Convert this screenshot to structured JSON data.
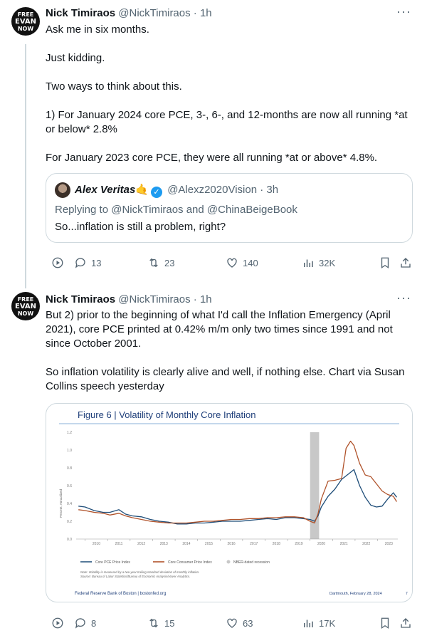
{
  "tweet1": {
    "avatar": {
      "line1": "FREE",
      "line2": "EVAN",
      "line3": "NOW"
    },
    "name": "Nick Timiraos",
    "handle": "@NickTimiraos",
    "time": "· 1h",
    "paragraphs": [
      "Ask me in six months.",
      "Just kidding.",
      "Two ways to think about this.",
      "1) For January 2024 core PCE, 3-, 6-, and 12-months are now all running *at or below* 2.8%",
      "For January 2023 core PCE, they were all running *at or above* 4.8%."
    ],
    "quote": {
      "name": "Alex Veritas",
      "emoji": "🤙",
      "handle": "@Alexz2020Vision",
      "time": "· 3h",
      "replying": "Replying to @NickTimiraos and @ChinaBeigeBook",
      "text": "So...inflation is still a problem, right?"
    },
    "actions": {
      "reply": "13",
      "retweet": "23",
      "like": "140",
      "views": "32K"
    }
  },
  "tweet2": {
    "name": "Nick Timiraos",
    "handle": "@NickTimiraos",
    "time": "· 1h",
    "paragraphs": [
      "But 2) prior to the beginning of what I'd call the Inflation Emergency (April 2021), core PCE printed at 0.42% m/m only two times since 1991 and not since October 2001.",
      "So inflation volatility is clearly alive and well, if nothing else. Chart via Susan Collins speech yesterday"
    ],
    "actions": {
      "reply": "8",
      "retweet": "15",
      "like": "63",
      "views": "17K"
    }
  },
  "chart_data": {
    "type": "line",
    "title": "Figure 6 | Volatility of Monthly Core Inflation",
    "ylabel": "Percent, Annualized",
    "ylim": [
      0.0,
      1.2
    ],
    "yticks": [
      "0.0",
      "0.2",
      "0.4",
      "0.6",
      "0.8",
      "1.0",
      "1.2"
    ],
    "xlim": [
      2009.6,
      2023.9
    ],
    "xticks": [
      "2010",
      "2011",
      "2012",
      "2013",
      "2014",
      "2015",
      "2016",
      "2017",
      "2018",
      "2019",
      "2020",
      "2021",
      "2022",
      "2023"
    ],
    "recession": [
      2020.0,
      2020.4
    ],
    "series": [
      {
        "name": "Core PCE Price Index",
        "color": "#1f4e79",
        "x": [
          2009.7,
          2010.0,
          2010.4,
          2010.8,
          2011.1,
          2011.5,
          2011.8,
          2012.1,
          2012.5,
          2012.9,
          2013.3,
          2013.7,
          2014.1,
          2014.5,
          2014.9,
          2015.3,
          2015.7,
          2016.1,
          2016.5,
          2016.9,
          2017.3,
          2017.7,
          2018.1,
          2018.5,
          2018.9,
          2019.3,
          2019.7,
          2020.0,
          2020.2,
          2020.35,
          2020.5,
          2020.8,
          2021.1,
          2021.4,
          2021.7,
          2021.95,
          2022.2,
          2022.45,
          2022.7,
          2022.95,
          2023.2,
          2023.45,
          2023.7,
          2023.85
        ],
        "y": [
          0.37,
          0.36,
          0.32,
          0.3,
          0.3,
          0.33,
          0.28,
          0.26,
          0.25,
          0.22,
          0.2,
          0.19,
          0.17,
          0.17,
          0.18,
          0.18,
          0.19,
          0.2,
          0.2,
          0.2,
          0.21,
          0.22,
          0.23,
          0.22,
          0.24,
          0.24,
          0.23,
          0.22,
          0.2,
          0.26,
          0.36,
          0.48,
          0.56,
          0.67,
          0.73,
          0.78,
          0.6,
          0.47,
          0.38,
          0.36,
          0.37,
          0.45,
          0.52,
          0.47
        ]
      },
      {
        "name": "Core Consumer Price Index",
        "color": "#b0532b",
        "x": [
          2009.7,
          2010.0,
          2010.4,
          2010.8,
          2011.1,
          2011.5,
          2011.8,
          2012.1,
          2012.5,
          2012.9,
          2013.3,
          2013.7,
          2014.1,
          2014.5,
          2014.9,
          2015.3,
          2015.7,
          2016.1,
          2016.5,
          2016.9,
          2017.3,
          2017.7,
          2018.1,
          2018.5,
          2018.9,
          2019.3,
          2019.7,
          2020.0,
          2020.2,
          2020.35,
          2020.5,
          2020.8,
          2021.1,
          2021.4,
          2021.6,
          2021.8,
          2021.95,
          2022.2,
          2022.45,
          2022.7,
          2022.95,
          2023.2,
          2023.45,
          2023.7,
          2023.85
        ],
        "y": [
          0.33,
          0.32,
          0.3,
          0.29,
          0.27,
          0.29,
          0.26,
          0.24,
          0.22,
          0.2,
          0.19,
          0.18,
          0.18,
          0.18,
          0.19,
          0.2,
          0.2,
          0.21,
          0.22,
          0.22,
          0.23,
          0.23,
          0.24,
          0.24,
          0.25,
          0.25,
          0.24,
          0.2,
          0.18,
          0.28,
          0.45,
          0.65,
          0.66,
          0.68,
          1.02,
          1.1,
          1.05,
          0.85,
          0.72,
          0.7,
          0.62,
          0.54,
          0.5,
          0.48,
          0.42
        ]
      }
    ],
    "legend": [
      "Core PCE Price Index",
      "Core Consumer Price Index",
      "NBER-dated recession"
    ],
    "note": "Note: Volatility is measured by a two-year trailing standard deviation of monthly inflation.",
    "source": "Source: Bureau of Labor Statistics/Bureau of Economic Analysis/Haver Analytics.",
    "footer_left": "Federal Reserve Bank of Boston | bostonfed.org",
    "footer_right": "Dartmouth, February 28, 2024",
    "page_number": "7"
  }
}
